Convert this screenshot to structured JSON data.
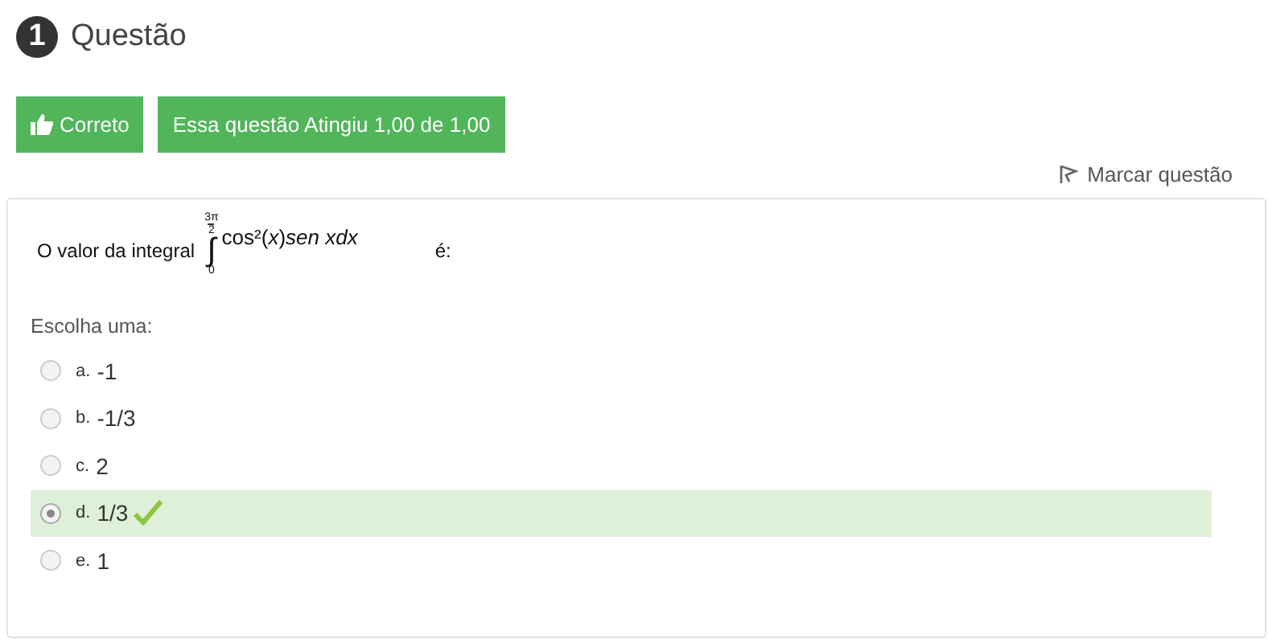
{
  "question": {
    "number": "1",
    "title": "Questão"
  },
  "status": {
    "result": "Correto",
    "grade": "Essa questão Atingiu 1,00 de 1,00"
  },
  "flag_link": "Marcar questão",
  "prompt": {
    "before": "O valor da integral",
    "upper_numerator": "3π",
    "upper_denominator": "2",
    "integral_sign": "∫",
    "lower": "0",
    "integrand": "cos²(*x*)*sen xdx*",
    "after": "é:"
  },
  "choose_label": "Escolha uma:",
  "options": [
    {
      "letter": "a.",
      "value": "-1",
      "selected": false,
      "correct": false
    },
    {
      "letter": "b.",
      "value": "-1/3",
      "selected": false,
      "correct": false
    },
    {
      "letter": "c.",
      "value": "2",
      "selected": false,
      "correct": false
    },
    {
      "letter": "d.",
      "value": "1/3",
      "selected": true,
      "correct": true
    },
    {
      "letter": "e.",
      "value": "1",
      "selected": false,
      "correct": false
    }
  ]
}
